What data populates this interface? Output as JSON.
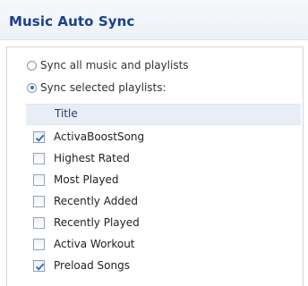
{
  "header": {
    "title": "Music Auto Sync"
  },
  "sync_options": [
    {
      "label": "Sync all music and playlists",
      "selected": false
    },
    {
      "label": "Sync selected playlists:",
      "selected": true
    }
  ],
  "playlist_table": {
    "column_title": "Title",
    "rows": [
      {
        "label": "ActivaBoostSong",
        "checked": true
      },
      {
        "label": "Highest Rated",
        "checked": false
      },
      {
        "label": "Most Played",
        "checked": false
      },
      {
        "label": "Recently Added",
        "checked": false
      },
      {
        "label": "Recently Played",
        "checked": false
      },
      {
        "label": "Activa Workout",
        "checked": false
      },
      {
        "label": "Preload Songs",
        "checked": true
      }
    ]
  }
}
